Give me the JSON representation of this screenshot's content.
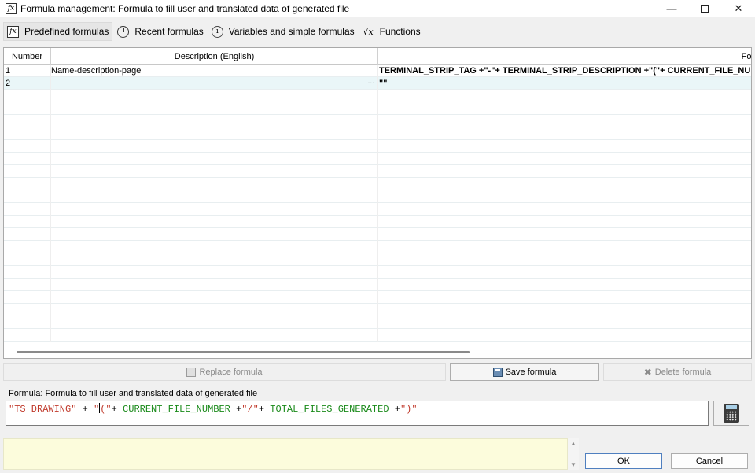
{
  "window": {
    "title": "Formula management: Formula to fill user and translated data of generated file",
    "icon": "fx-icon"
  },
  "toolbar": {
    "items": [
      {
        "label": "Predefined formulas",
        "icon": "fx-icon"
      },
      {
        "label": "Recent formulas",
        "icon": "clock-icon"
      },
      {
        "label": "Variables and simple formulas",
        "icon": "info-icon"
      },
      {
        "label": "Functions",
        "icon": "sqrt-icon"
      }
    ]
  },
  "grid": {
    "columns": [
      "Number",
      "Description (English)",
      "Formula"
    ],
    "rows": [
      {
        "number": "1",
        "description": "Name-description-page",
        "formula": "TERMINAL_STRIP_TAG +\"-\"+ TERMINAL_STRIP_DESCRIPTION +\"(\"+ CURRENT_FILE_NUM"
      },
      {
        "number": "2",
        "description": "",
        "formula": "\"\"",
        "ellipsis": "..."
      }
    ]
  },
  "actions": {
    "replace": "Replace formula",
    "save": "Save formula",
    "delete": "Delete formula"
  },
  "formula": {
    "label": "Formula: Formula to fill user and translated data of generated file",
    "tokens": {
      "t1": "\"TS DRAWING\"",
      "t2": " + ",
      "t3": "\"",
      "t4": "(\"",
      "t5": "+ ",
      "t6": "CURRENT_FILE_NUMBER",
      "t7": " +",
      "t8": "\"/\"",
      "t9": "+ ",
      "t10": "TOTAL_FILES_GENERATED",
      "t11": " +",
      "t12": "\")\""
    }
  },
  "dialog": {
    "ok": "OK",
    "cancel": "Cancel"
  },
  "colors": {
    "string": "#c0392b",
    "variable": "#1a8a1a",
    "message_bg": "#fcfcdc",
    "selected_row": "#eaf6f8"
  }
}
